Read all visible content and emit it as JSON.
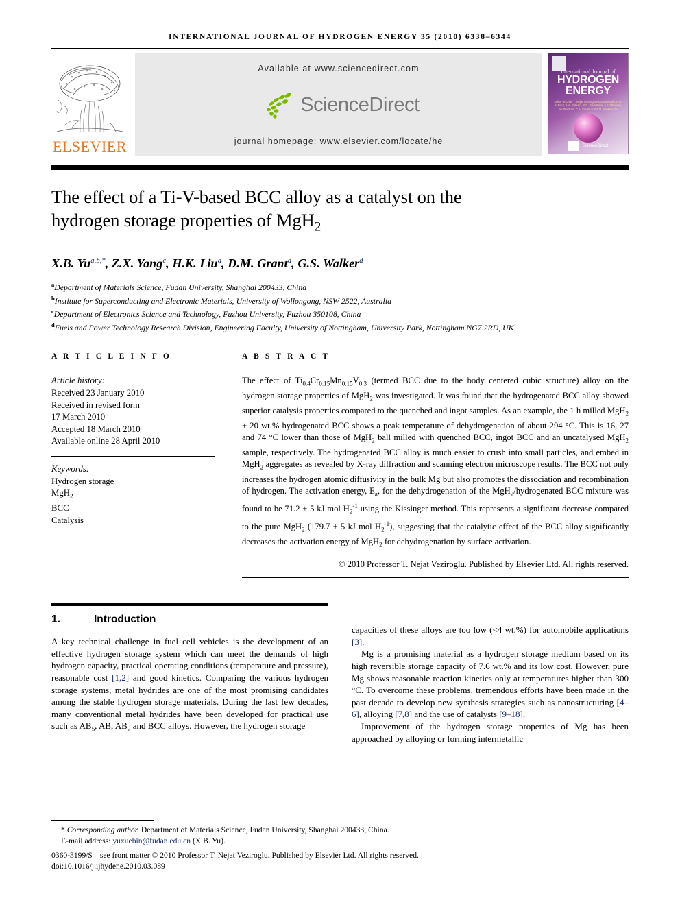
{
  "running_head": "International Journal of Hydrogen Energy 35 (2010) 6338–6344",
  "banner": {
    "publisher_name": "ELSEVIER",
    "available_at": "Available at www.sciencedirect.com",
    "sciencedirect_word": "ScienceDirect",
    "journal_homepage": "journal homepage: www.elsevier.com/locate/he",
    "cover": {
      "line1": "International Journal of",
      "line2": "HYDROGEN",
      "line3": "ENERGY",
      "editors": "Editor-in-Chief  T. Nejat Veziroglu     Associate Editors  D. Akbulut, A.A. Bakulin, R.C. Srivastava, A.F. Dhandev, Ian Stanford, C.A. Conall and S.R. Venkatesha",
      "sciencedirect_label": "ScienceDirect"
    },
    "accent_orange": "#E87722",
    "banner_gray": "#e9e9e9"
  },
  "article": {
    "title": "The effect of a Ti-V-based BCC alloy as a catalyst on the hydrogen storage properties of MgH2",
    "title_part1": "The effect of a Ti-V-based BCC alloy as a catalyst on the",
    "title_part2": "hydrogen storage properties of MgH",
    "title_sub": "2",
    "authors": [
      {
        "name": "X.B. Yu",
        "marks": "a,b,*"
      },
      {
        "name": "Z.X. Yang",
        "marks": "c"
      },
      {
        "name": "H.K. Liu",
        "marks": "a"
      },
      {
        "name": "D.M. Grant",
        "marks": "d"
      },
      {
        "name": "G.S. Walker",
        "marks": "d"
      }
    ],
    "affiliations": [
      {
        "mark": "a",
        "text": "Department of Materials Science, Fudan University, Shanghai 200433, China"
      },
      {
        "mark": "b",
        "text": "Institute for Superconducting and Electronic Materials, University of Wollongong, NSW 2522, Australia"
      },
      {
        "mark": "c",
        "text": "Department of Electronics Science and Technology, Fuzhou University, Fuzhou 350108, China"
      },
      {
        "mark": "d",
        "text": "Fuels and Power Technology Research Division, Engineering Faculty, University of Nottingham, University Park, Nottingham NG7 2RD, UK"
      }
    ]
  },
  "article_info": {
    "heading": "A R T I C L E    I N F O",
    "history_label": "Article history:",
    "history": [
      "Received 23 January 2010",
      "Received in revised form",
      "17 March 2010",
      "Accepted 18 March 2010",
      "Available online 28 April 2010"
    ],
    "keywords_label": "Keywords:",
    "keywords": [
      "Hydrogen storage",
      "MgH2",
      "BCC",
      "Catalysis"
    ],
    "keyword_mgh2_base": "MgH",
    "keyword_mgh2_sub": "2"
  },
  "abstract": {
    "heading": "A B S T R A C T",
    "text_segments": [
      "The effect of Ti",
      "0.4",
      "Cr",
      "0.15",
      "Mn",
      "0.15",
      "V",
      "0.3",
      " (termed BCC due to the body centered cubic structure) alloy on the hydrogen storage properties of MgH2 was investigated. It was found that the hydrogenated BCC alloy showed superior catalysis properties compared to the quenched and ingot samples. As an example, the 1 h milled MgH2 + 20 wt.% hydrogenated BCC shows a peak temperature of dehydrogenation of about 294 °C. This is 16, 27 and 74 °C lower than those of MgH2 ball milled with quenched BCC, ingot BCC and an uncatalysed MgH2 sample, respectively. The hydrogenated BCC alloy is much easier to crush into small particles, and embed in MgH2 aggregates as revealed by X-ray diffraction and scanning electron microscope results. The BCC not only increases the hydrogen atomic diffusivity in the bulk Mg but also promotes the dissociation and recombination of hydrogen. The activation energy, Ea, for the dehydrogenation of the MgH2/hydrogenated BCC mixture was found to be 71.2 ± 5 kJ mol H2-1 using the Kissinger method. This represents a significant decrease compared to the pure MgH2 (179.7 ± 5 kJ mol H2-1), suggesting that the catalytic effect of the BCC alloy significantly decreases the activation energy of MgH2 for dehydrogenation by surface activation."
    ],
    "copyright": "© 2010 Professor T. Nejat Veziroglu. Published by Elsevier Ltd. All rights reserved."
  },
  "introduction": {
    "number": "1.",
    "heading": "Introduction",
    "left_paragraph": "A key technical challenge in fuel cell vehicles is the development of an effective hydrogen storage system which can meet the demands of high hydrogen capacity, practical operating conditions (temperature and pressure), reasonable cost [1,2] and good kinetics. Comparing the various hydrogen storage systems, metal hydrides are one of the most promising candidates among the stable hydrogen storage materials. During the last few decades, many conventional metal hydrides have been developed for practical use such as AB5, AB, AB2 and BCC alloys. However, the hydrogen storage",
    "right_paragraph_1": "capacities of these alloys are too low (<4 wt.%) for automobile applications [3].",
    "right_paragraph_2": "Mg is a promising material as a hydrogen storage medium based on its high reversible storage capacity of 7.6 wt.% and its low cost. However, pure Mg shows reasonable reaction kinetics only at temperatures higher than 300 °C. To overcome these problems, tremendous efforts have been made in the past decade to develop new synthesis strategies such as nanostructuring [4–6], alloying [7,8] and the use of catalysts [9–18].",
    "right_paragraph_3": "Improvement of the hydrogen storage properties of Mg has been approached by alloying or forming intermetallic",
    "citations": [
      "[1,2]",
      "[3]",
      "[4–6]",
      "[7,8]",
      "[9–18]"
    ],
    "citation_color": "#1a2a6c"
  },
  "footer": {
    "corresponding_mark": "*",
    "corresponding_label": "Corresponding author.",
    "corresponding_text": " Department of Materials Science, Fudan University, Shanghai 200433, China.",
    "email_label": "E-mail address:",
    "email": "yuxuebin@fudan.edu.cn",
    "email_suffix": " (X.B. Yu).",
    "issn_line": "0360-3199/$ – see front matter © 2010 Professor T. Nejat Veziroglu. Published by Elsevier Ltd. All rights reserved.",
    "doi": "doi:10.1016/j.ijhydene.2010.03.089"
  }
}
